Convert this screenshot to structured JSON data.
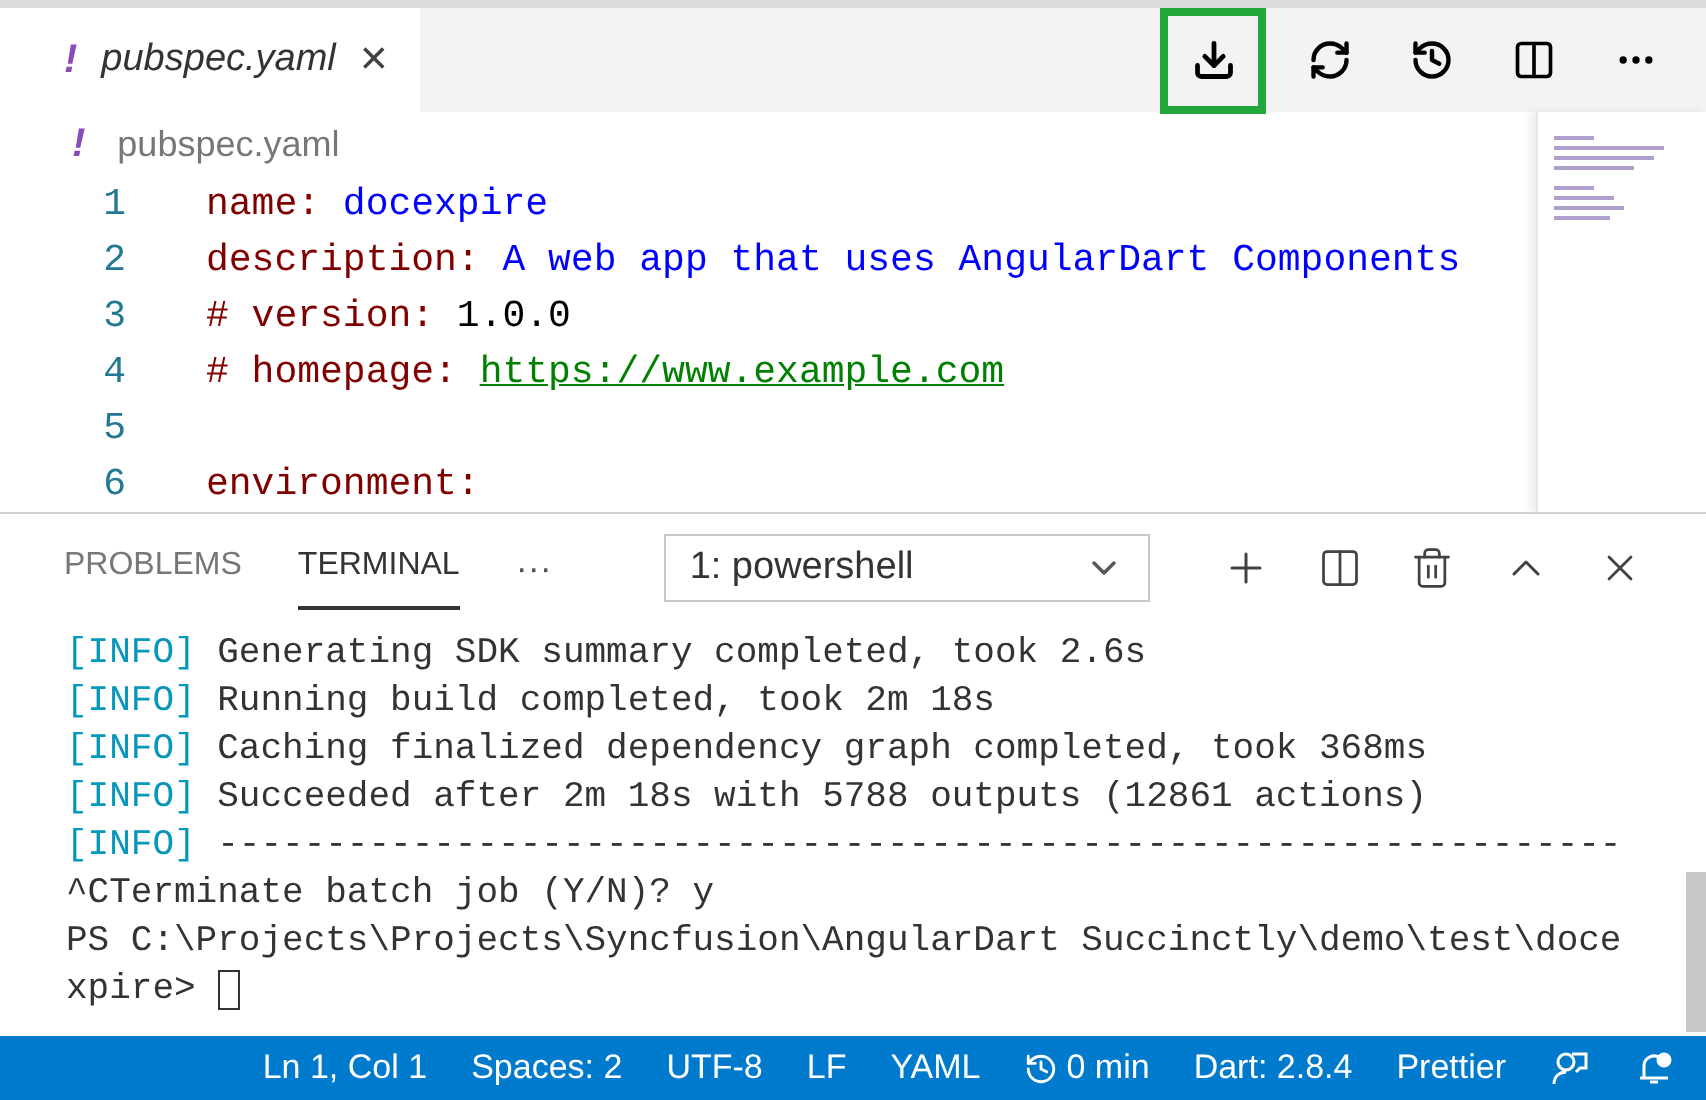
{
  "editor_tabs": [
    {
      "icon": "!",
      "label": "pubspec.yaml",
      "selected": true,
      "close": "×"
    }
  ],
  "breadcrumb": {
    "icon": "!",
    "label": "pubspec.yaml"
  },
  "code_lines": [
    {
      "number": "1",
      "tokens": [
        {
          "kind": "key",
          "text": "name:"
        },
        {
          "kind": "value",
          "text": " docexpire"
        }
      ]
    },
    {
      "number": "2",
      "tokens": [
        {
          "kind": "key",
          "text": "description:"
        },
        {
          "kind": "value",
          "text": " A web app that uses AngularDart Components"
        }
      ]
    },
    {
      "number": "3",
      "tokens": [
        {
          "kind": "key",
          "text": "# version:"
        },
        {
          "kind": "plain",
          "text": " 1.0.0"
        }
      ]
    },
    {
      "number": "4",
      "tokens": [
        {
          "kind": "key",
          "text": "# homepage: "
        },
        {
          "kind": "link",
          "text": "https://www.example.com"
        }
      ]
    },
    {
      "number": "5"
    },
    {
      "number": "6",
      "tokens": [
        {
          "kind": "key",
          "text": "environment:"
        }
      ]
    }
  ],
  "panel": {
    "tabs": [
      {
        "label": "PROBLEMS",
        "selected": false
      },
      {
        "label": "TERMINAL",
        "selected": true
      }
    ],
    "more": "···",
    "terminal_select": "1: powershell"
  },
  "terminal_lines": [
    {
      "tag": "[INFO]",
      "text": " Generating SDK summary completed, took 2.6s"
    },
    {
      "tag": "[INFO]",
      "text": " Running build completed, took 2m 18s"
    },
    {
      "tag": "[INFO]",
      "text": " Caching finalized dependency graph completed, took 368ms"
    },
    {
      "tag": "[INFO]",
      "text": " Succeeded after 2m 18s with 5788 outputs (12861 actions)"
    },
    {
      "tag": "[INFO]",
      "text": " -----------------------------------------------------------------"
    },
    {
      "text": "^CTerminate batch job (Y/N)? y"
    },
    {
      "text": "PS C:\\Projects\\Projects\\Syncfusion\\AngularDart Succinctly\\demo\\test\\doce"
    },
    {
      "text": "xpire> ",
      "cursor": true
    }
  ],
  "status_bar": [
    "Ln 1, Col 1",
    "Spaces: 2",
    "UTF-8",
    "LF",
    "YAML",
    "0 min",
    "Dart: 2.8.4",
    "Prettier"
  ]
}
